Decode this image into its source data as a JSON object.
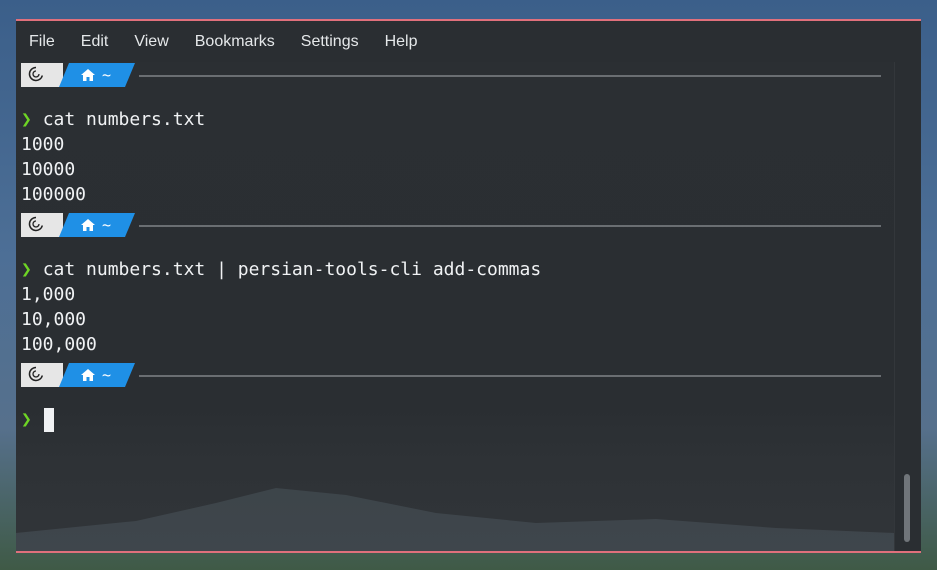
{
  "menu": [
    "File",
    "Edit",
    "View",
    "Bookmarks",
    "Settings",
    "Help"
  ],
  "prompt": {
    "dir_label": "~",
    "arrow": "❯"
  },
  "blocks": [
    {
      "command": "cat numbers.txt",
      "output": [
        "1000",
        "10000",
        "100000"
      ]
    },
    {
      "command": "cat numbers.txt | persian-tools-cli add-commas",
      "output": [
        "1,000",
        "10,000",
        "100,000"
      ]
    }
  ],
  "colors": {
    "accent_border": "#e0707c",
    "prompt_dir_bg": "#1f90e6",
    "prompt_arrow": "#6ed425",
    "terminal_bg": "#2a2e32"
  },
  "icons": {
    "os": "debian-swirl-icon",
    "home": "home-icon"
  }
}
